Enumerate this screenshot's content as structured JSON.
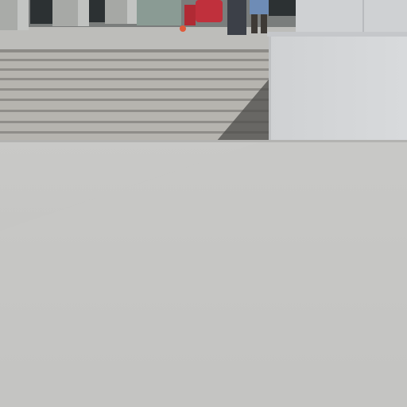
{
  "image": {
    "subject": "photograph",
    "colors": {
      "plaza": "#c6c6c4",
      "plaza_shadow": "#bdbdbb",
      "stairs_light": "#b9b7b2",
      "stairs_dark": "#8f8d89",
      "wall": "#d4d6d8",
      "wall_top": "#c8cacd",
      "building_dark": "#2c3133",
      "column": "#a9aba8",
      "person_red": "#c0303c",
      "person_dark": "#3c4048",
      "person_jeans": "#6e8cb6"
    }
  }
}
